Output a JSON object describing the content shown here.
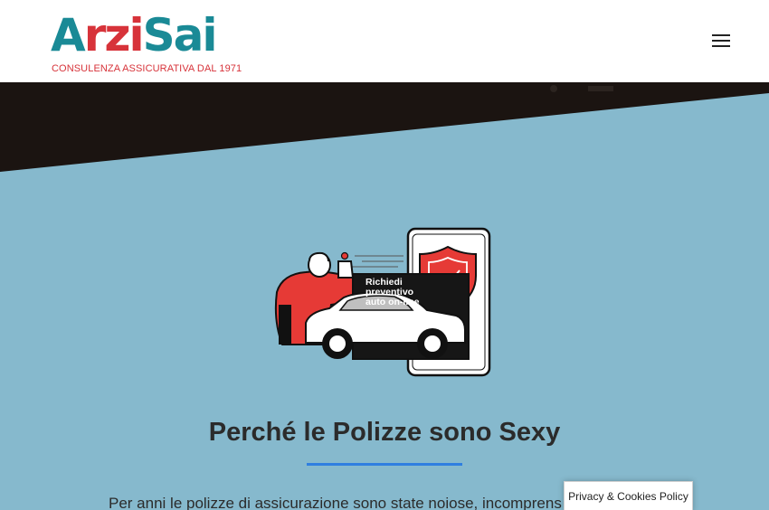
{
  "header": {
    "logo": {
      "part_a": "A",
      "part_rzi": "rzi",
      "part_sai": "Sai",
      "tagline": "CONSULENZA ASSICURATIVA DAL 1971"
    },
    "menu_icon": "hamburger-menu-icon"
  },
  "hero": {
    "illustration": {
      "sign_text": "Richiedi preventivo auto on-line",
      "icons": [
        "person",
        "car",
        "smartphone",
        "shield-check-icon"
      ]
    },
    "headline": "Perché le Polizze sono Sexy",
    "body_text": "Per anni le polizze di assicurazione sono state noiose, incomprens"
  },
  "cookie_banner": {
    "label": "Privacy & Cookies Policy"
  },
  "colors": {
    "background": "#86b9cd",
    "dark_band": "#1b1411",
    "accent_blue": "#2f7fe0",
    "brand_red": "#d7333a",
    "brand_teal": "#1a8a96"
  }
}
